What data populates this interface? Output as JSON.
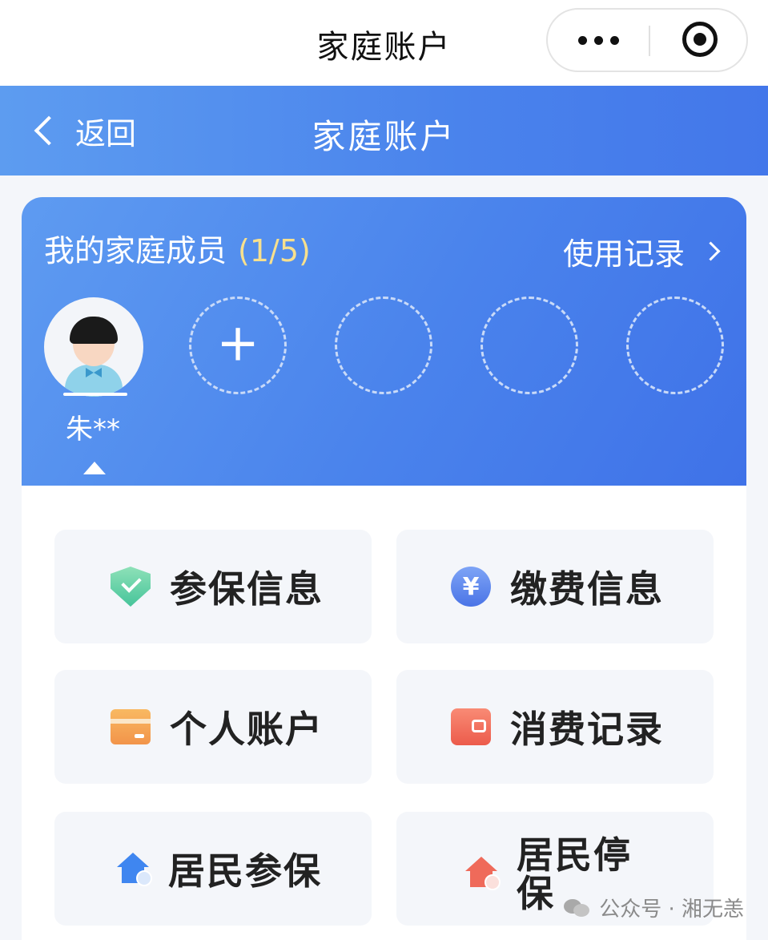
{
  "top_bar": {
    "title": "家庭账户"
  },
  "header": {
    "back_label": "返回",
    "title": "家庭账户"
  },
  "family_card": {
    "title": "我的家庭成员",
    "count": "(1/5)",
    "usage_record": "使用记录",
    "members": [
      {
        "name": "朱**"
      }
    ],
    "add_symbol": "+"
  },
  "menu": {
    "tiles": [
      {
        "label": "参保信息",
        "icon": "shield-check-icon"
      },
      {
        "label": "缴费信息",
        "icon": "yuan-coin-icon",
        "glyph": "¥"
      },
      {
        "label": "个人账户",
        "icon": "card-icon"
      },
      {
        "label": "消费记录",
        "icon": "wallet-icon"
      },
      {
        "label": "居民参保",
        "icon": "house-check-icon"
      },
      {
        "label": "居民停保",
        "icon": "house-stop-icon"
      }
    ]
  },
  "watermark": {
    "text": "公众号 · 湘无恙"
  },
  "colors": {
    "header_blue": "#4a83ec",
    "card_blue": "#4377ea",
    "count_yellow": "#f7e08e"
  }
}
